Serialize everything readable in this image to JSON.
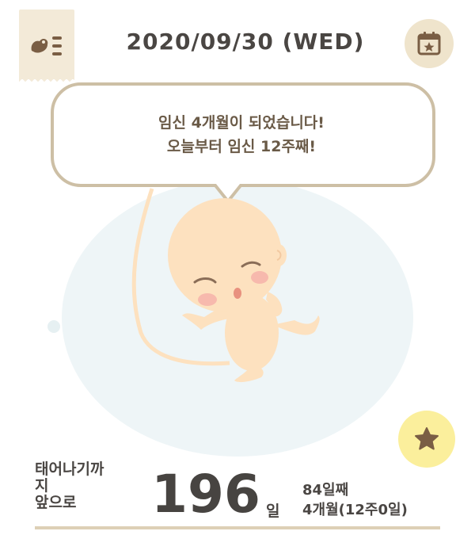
{
  "header": {
    "date": "2020/09/30 (WED)",
    "menu_icon": "fetus-list-icon",
    "calendar_icon": "calendar-star-icon"
  },
  "bubble": {
    "line1": "임신 4개월이 되었습니다!",
    "line2": "오늘부터 임신 12주째!"
  },
  "footer": {
    "until_label_line1": "태어나기까",
    "until_label_line2": "지",
    "until_label_line3": "앞으로",
    "days_left": "196",
    "days_unit": "일",
    "day_count": "84일째",
    "month_week": "4개월(12주0일)",
    "star_icon": "star-icon"
  },
  "colors": {
    "tab_bg": "#f3ead8",
    "icon_brown": "#7a5e44",
    "bubble_border": "#cdbfa5",
    "womb_bg": "#eef5f7",
    "fetus_skin": "#fde1bf",
    "cheek": "#f7b9ad",
    "star_bg": "#fbef9c",
    "accent_line": "#ddd0b6"
  }
}
